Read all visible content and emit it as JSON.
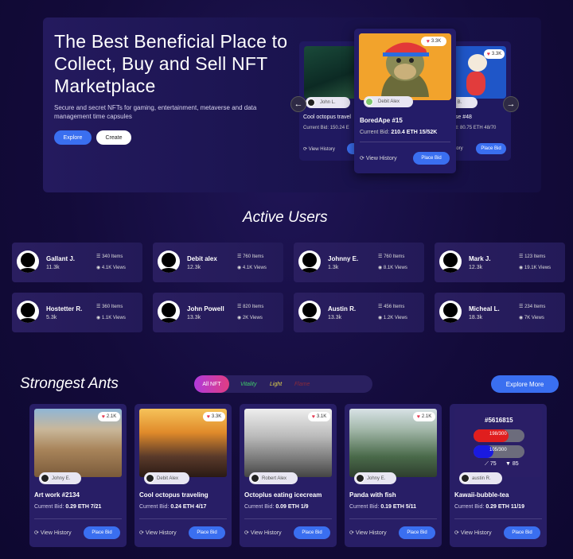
{
  "hero": {
    "title": "The Best Beneficial Place to Collect, Buy and Sell NFT Marketplace",
    "subtitle": "Secure and secret NFTs for gaming, entertainment, metaverse and data management time capsules",
    "explore_label": "Explore",
    "create_label": "Create"
  },
  "carousel": {
    "prev_icon": "arrow-left-icon",
    "next_icon": "arrow-right-icon",
    "left_card": {
      "owner": "John L.",
      "title": "Cool octopus travel",
      "bid_label": "Current Bid:",
      "bid": "150.24 E",
      "history": "View History",
      "place": "Place Bid"
    },
    "center_card": {
      "likes": "3.3K",
      "owner": "Debit Alex",
      "title": "BoredApe #15",
      "bid_label": "Current Bid:",
      "bid": "210.4 ETH 15/52K",
      "history": "View History",
      "place": "Place Bid"
    },
    "right_card": {
      "likes": "3.3K",
      "owner": "rk B.",
      "title": "use #48",
      "bid_label": "Bid:",
      "bid": "80.75 ETH 48/70",
      "history": "iistory",
      "place": "Place Bid"
    }
  },
  "active_users": {
    "title": "Active Users",
    "users": [
      {
        "name": "Gallant J.",
        "value": "11.3k",
        "items": "340 Items",
        "views": "4.1K Views"
      },
      {
        "name": "Debit alex",
        "value": "12.3k",
        "items": "760 Items",
        "views": "4.1K Views"
      },
      {
        "name": "Johnny E.",
        "value": "1.3k",
        "items": "760 Items",
        "views": "8.1K Views"
      },
      {
        "name": "Mark J.",
        "value": "12.3k",
        "items": "123 Items",
        "views": "19.1K Views"
      },
      {
        "name": "Hostetter R.",
        "value": "5.3k",
        "items": "360 Items",
        "views": "1.1K Views"
      },
      {
        "name": "John Powell",
        "value": "13.3k",
        "items": "820 Items",
        "views": "2K Views"
      },
      {
        "name": "Austin R.",
        "value": "13.3k",
        "items": "456 Items",
        "views": "1.2K Views"
      },
      {
        "name": "Micheal L.",
        "value": "18.3k",
        "items": "234 Items",
        "views": "7K Views"
      }
    ]
  },
  "strongest": {
    "title": "Strongest Ants",
    "tabs": [
      "All NFT",
      "Vitality",
      "Light",
      "Flame"
    ],
    "tab_colors": [
      "#ffffff",
      "#3ecf6a",
      "#e6d84a",
      "#e0445a"
    ],
    "explore_more": "Explore More",
    "cards": [
      {
        "likes": "2.1K",
        "owner": "Johny E.",
        "title": "Art work #2134",
        "bid_label": "Current Bid:",
        "bid": "0.29 ETH 7/21",
        "history": "View History",
        "place": "Place Bid"
      },
      {
        "likes": "3.3K",
        "owner": "Debit Alex",
        "title": "Cool octopus traveling",
        "bid_label": "Current Bid:",
        "bid": "0.24 ETH 4/17",
        "history": "View History",
        "place": "Place Bid"
      },
      {
        "likes": "3.1K",
        "owner": "Robert Alex",
        "title": "Octoplus eating icecream",
        "bid_label": "Current Bid:",
        "bid": "0.09 ETH 1/9",
        "history": "View History",
        "place": "Place Bid"
      },
      {
        "likes": "2.1K",
        "owner": "Johny E.",
        "title": "Panda with fish",
        "bid_label": "Current Bid:",
        "bid": "0.19 ETH 5/11",
        "history": "View History",
        "place": "Place Bid"
      },
      {
        "likes": "",
        "owner": "austin R.",
        "title": "Kawaii-bubble-tea",
        "bid_label": "Current Bid:",
        "bid": "0.29 ETH 11/19",
        "history": "View History",
        "place": "Place Bid",
        "stats": {
          "id": "#5616815",
          "hp": "198/300",
          "hp_fraction": 0.66,
          "mp": "105/300",
          "mp_fraction": 0.35,
          "attack": "75",
          "defense": "85"
        }
      }
    ]
  }
}
